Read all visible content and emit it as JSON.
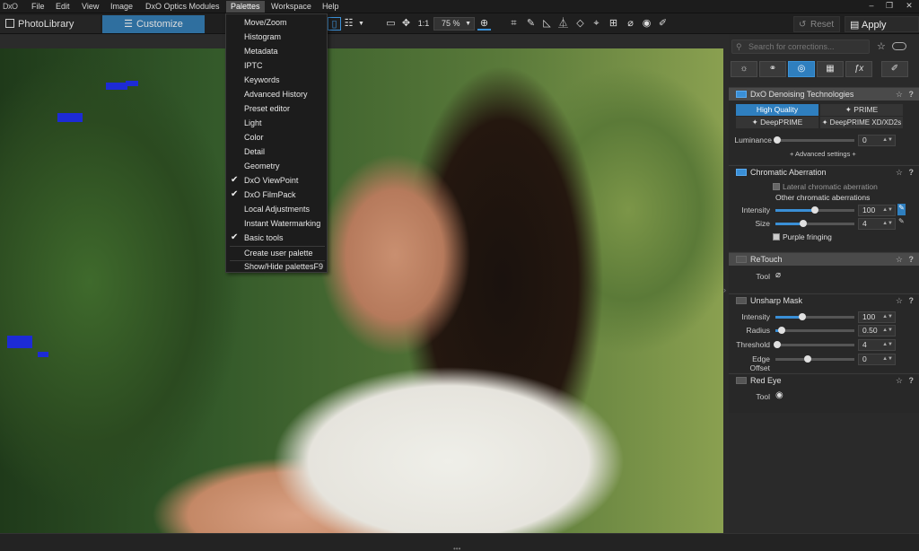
{
  "app": {
    "logo": "DxO"
  },
  "menubar": {
    "items": [
      "File",
      "Edit",
      "View",
      "Image",
      "DxO Optics Modules",
      "Palettes",
      "Workspace",
      "Help"
    ],
    "window_buttons": [
      "–",
      "❐",
      "✕"
    ]
  },
  "toolbar": {
    "tab_photolibrary": "PhotoLibrary",
    "tab_customize": "Customize",
    "zoom_1to1": "1:1",
    "zoom_level": "75 %",
    "reset": "Reset",
    "apply_preset": "Apply preset"
  },
  "palettes_menu": {
    "items": [
      {
        "label": "Move/Zoom",
        "checked": false
      },
      {
        "label": "Histogram",
        "checked": false
      },
      {
        "label": "Metadata",
        "checked": false
      },
      {
        "label": "IPTC",
        "checked": false
      },
      {
        "label": "Keywords",
        "checked": false
      },
      {
        "label": "Advanced History",
        "checked": false
      },
      {
        "label": "Preset editor",
        "checked": false
      },
      {
        "label": "Light",
        "checked": false
      },
      {
        "label": "Color",
        "checked": false
      },
      {
        "label": "Detail",
        "checked": false
      },
      {
        "label": "Geometry",
        "checked": false
      },
      {
        "label": "DxO ViewPoint",
        "checked": true
      },
      {
        "label": "DxO FilmPack",
        "checked": true
      },
      {
        "label": "Local Adjustments",
        "checked": false
      },
      {
        "label": "Instant Watermarking",
        "checked": false
      },
      {
        "label": "Basic tools",
        "checked": true
      }
    ],
    "create_user_palette": "Create user palette",
    "show_hide_palettes": "Show/Hide palettes",
    "show_hide_shortcut": "F9"
  },
  "right_panel": {
    "search_placeholder": "Search for corrections...",
    "tab_icons": [
      "sun-icon",
      "color-circles-icon",
      "lens-icon",
      "layers-icon",
      "fx-icon",
      "brush-icon"
    ],
    "denoising": {
      "title": "DxO Denoising Technologies",
      "mode_high_quality": "High Quality",
      "mode_prime": "PRIME",
      "mode_deepprime": "DeepPRIME",
      "mode_deepprime_xd": "DeepPRIME XD/XD2s",
      "luminance_label": "Luminance",
      "luminance_value": "0",
      "luminance_level": 0,
      "advanced_settings": "+ Advanced settings +"
    },
    "chromatic": {
      "title": "Chromatic Aberration",
      "lateral": "Lateral chromatic aberration",
      "other": "Other chromatic aberrations",
      "intensity_label": "Intensity",
      "intensity_value": "100",
      "intensity_level": 0.5,
      "size_label": "Size",
      "size_value": "4",
      "size_level": 0.35,
      "purple_fringing": "Purple fringing"
    },
    "retouch": {
      "title": "ReTouch",
      "tool_label": "Tool"
    },
    "unsharp": {
      "title": "Unsharp Mask",
      "intensity_label": "Intensity",
      "intensity_value": "100",
      "intensity_level": 0.33,
      "radius_label": "Radius",
      "radius_value": "0.50",
      "radius_level": 0.05,
      "threshold_label": "Threshold",
      "threshold_value": "4",
      "threshold_level": 0.0,
      "edge_label": "Edge Offset",
      "edge_value": "0",
      "edge_level": 0.33
    },
    "redeye": {
      "title": "Red Eye",
      "tool_label": "Tool"
    }
  },
  "colors": {
    "accent": "#3a8fd6",
    "customize_tab": "#2f6f9f",
    "fringe_mask": "#1d2bd6"
  }
}
